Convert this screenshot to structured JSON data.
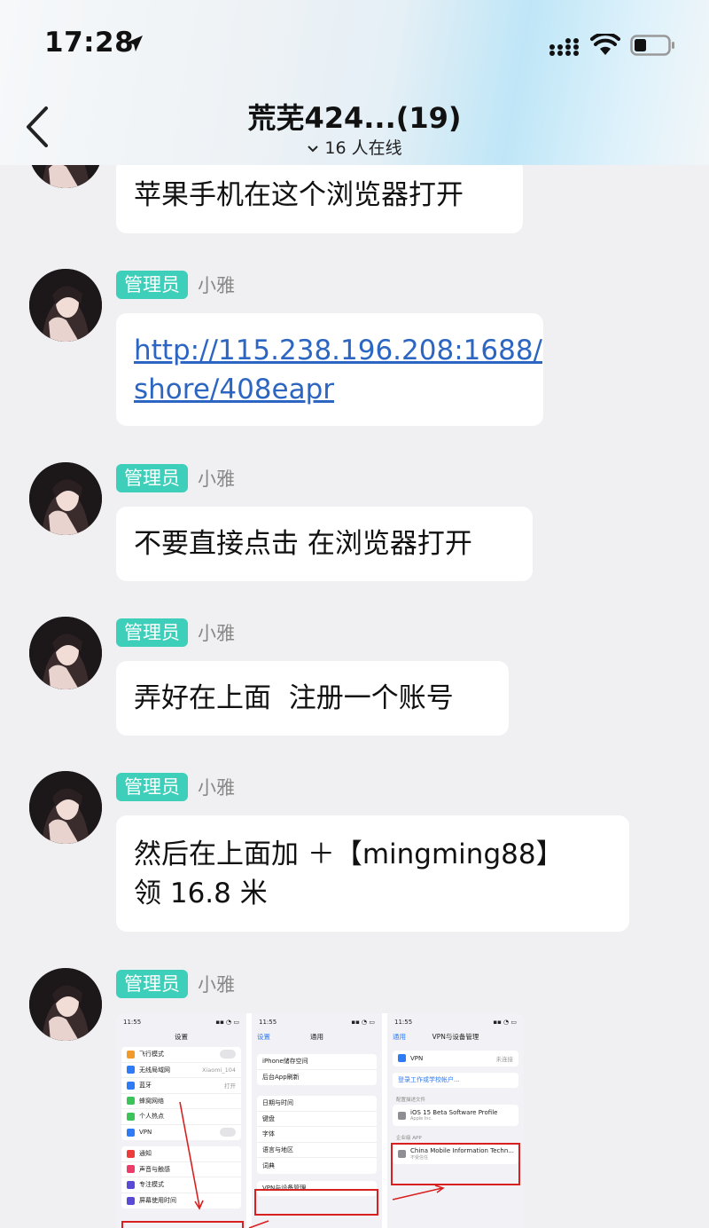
{
  "status_bar": {
    "time": "17:28"
  },
  "header": {
    "title": "荒芜424...(19)",
    "online": "16 人在线"
  },
  "messages": [
    {
      "text": "苹果手机在这个浏览器打开"
    },
    {
      "role": "管理员",
      "sender": "小雅",
      "link_line1": "http://115.238.196.208:1688/",
      "link_line2": "shore/408eapr"
    },
    {
      "role": "管理员",
      "sender": "小雅",
      "text": "不要直接点击 在浏览器打开"
    },
    {
      "role": "管理员",
      "sender": "小雅",
      "text": "弄好在上面  注册一个账号"
    },
    {
      "role": "管理员",
      "sender": "小雅",
      "line1": "然后在上面加 ＋【mingming88】",
      "line2": "领 16.8 米"
    },
    {
      "role": "管理员",
      "sender": "小雅"
    }
  ],
  "screenshot_image": {
    "pane1": {
      "time": "11:55",
      "title": "设置",
      "rows_a": [
        "飞行模式",
        "无线局域网",
        "蓝牙",
        "蜂窝网络",
        "个人热点",
        "VPN"
      ],
      "wifi_value": "Xiaomi_104",
      "bt_value": "打开",
      "rows_b": [
        "通知",
        "声音与触感",
        "专注模式",
        "屏幕使用时间"
      ]
    },
    "pane2": {
      "time": "11:55",
      "back": "设置",
      "title": "通用",
      "rows_a": [
        "iPhone储存空间",
        "后台App刷新"
      ],
      "rows_b": [
        "日期与时间",
        "键盘",
        "字体",
        "语言与地区",
        "词典"
      ],
      "vpn_row": "VPN与设备管理"
    },
    "pane3": {
      "time": "11:55",
      "back": "通用",
      "title": "VPN与设备管理",
      "vpn_label": "VPN",
      "vpn_value": "未连接",
      "signin": "登录工作或学校帐户...",
      "section1": "配置描述文件",
      "profile_name": "iOS 15 Beta Software Profile",
      "profile_sub": "Apple Inc.",
      "section2": "企业级 APP",
      "app_name": "China Mobile Information Techn...",
      "app_sub": "不受信任"
    }
  }
}
